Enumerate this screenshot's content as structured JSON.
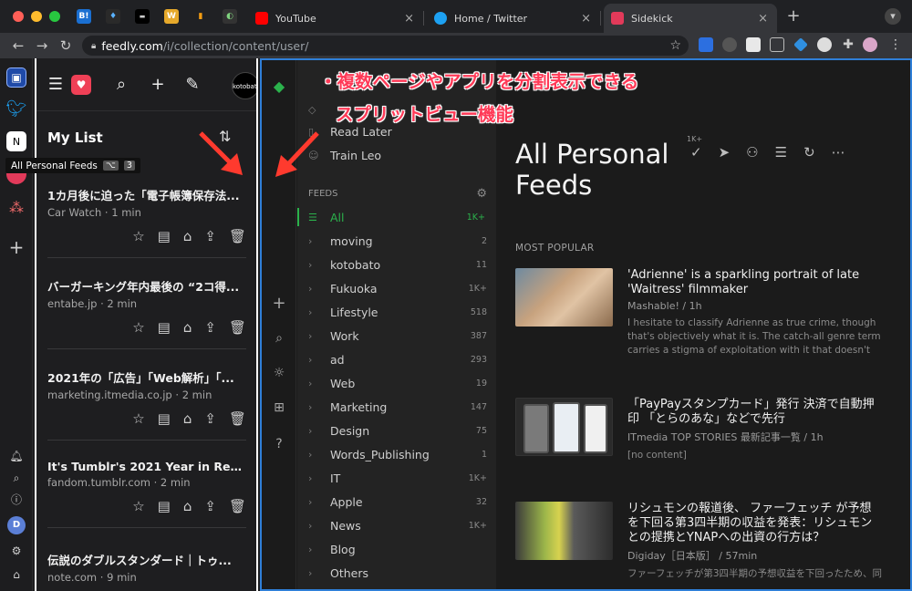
{
  "browser": {
    "tabs": [
      {
        "label": "YouTube",
        "color": "#ff0000"
      },
      {
        "label": "Home / Twitter",
        "color": "#1da1f2"
      },
      {
        "label": "Sidekick",
        "color": "#e23a5a"
      }
    ],
    "pinned_tabs": [
      "B!",
      "♦",
      "▬",
      "W",
      "▮",
      "◐"
    ],
    "new_tab": "+",
    "url_host": "feedly.com",
    "url_path": "/i/collection/content/user/"
  },
  "sidebar": {
    "avatar_letter": "D"
  },
  "pocket": {
    "list_title": "My List",
    "profile_label": "kotobato",
    "tooltip_label": "All Personal Feeds",
    "tooltip_shortcut": "⌥",
    "tooltip_key": "3",
    "items": [
      {
        "title": "1カ月後に迫った「電子帳簿保存法...",
        "meta": "Car Watch · 1 min"
      },
      {
        "title": "バーガーキング年内最後の “2コ得...",
        "meta": "entabe.jp · 2 min"
      },
      {
        "title": "2021年の「広告」「Web解析」「...",
        "meta": "marketing.itmedia.co.jp · 2 min"
      },
      {
        "title": "It's Tumblr's 2021 Year in Review!",
        "meta": "fandom.tumblr.com · 2 min"
      },
      {
        "title": "伝説のダブルスタンダード｜トゥ...",
        "meta": "note.com · 9 min"
      }
    ]
  },
  "feedly": {
    "nav_top": [
      "Read Later",
      "Train Leo"
    ],
    "feeds_label": "FEEDS",
    "feeds": [
      {
        "name": "All",
        "count": "1K+",
        "active": true
      },
      {
        "name": "moving",
        "count": "2"
      },
      {
        "name": "kotobato",
        "count": "11"
      },
      {
        "name": "Fukuoka",
        "count": "1K+"
      },
      {
        "name": "Lifestyle",
        "count": "518"
      },
      {
        "name": "Work",
        "count": "387"
      },
      {
        "name": "ad",
        "count": "293"
      },
      {
        "name": "Web",
        "count": "19"
      },
      {
        "name": "Marketing",
        "count": "147"
      },
      {
        "name": "Design",
        "count": "75"
      },
      {
        "name": "Words_Publishing",
        "count": "1"
      },
      {
        "name": "IT",
        "count": "1K+"
      },
      {
        "name": "Apple",
        "count": "32"
      },
      {
        "name": "News",
        "count": "1K+"
      },
      {
        "name": "Blog",
        "count": ""
      },
      {
        "name": "Others",
        "count": ""
      }
    ],
    "page_title": "All Personal Feeds",
    "unread_badge": "1K+",
    "section": "MOST POPULAR",
    "articles": [
      {
        "headline": "'Adrienne' is a sparkling portrait of late 'Waitress' filmmaker",
        "source": "Mashable! / 1h",
        "summary": "I hesitate to classify Adrienne as true crime, though that's objectively what it is. The catch-all genre term carries a stigma of exploitation with it that doesn't"
      },
      {
        "headline": "「PayPayスタンプカード」発行 決済で自動押印 「とらのあな」などで先行",
        "source": "ITmedia TOP STORIES 最新記事一覧 / 1h",
        "summary": "[no content]"
      },
      {
        "headline": "リシュモンの報道後、 ファーフェッチ が予想を下回る第3四半期の収益を発表：リシュモンとの提携とYNAPへの出資の行方は？",
        "source": "Digiday［日本版］ / 57min",
        "summary": "ファーフェッチが第3四半期の予想収益を下回ったため、同"
      }
    ]
  },
  "callout": {
    "line1": "・複数ページやアプリを分割表示できる",
    "line2": "スプリットビュー機能"
  },
  "colors": {
    "feedly_green": "#2bb24c",
    "pocket_red": "#ef4056",
    "callout_red": "#ff3a57",
    "focus_blue": "#2f7fd8"
  }
}
